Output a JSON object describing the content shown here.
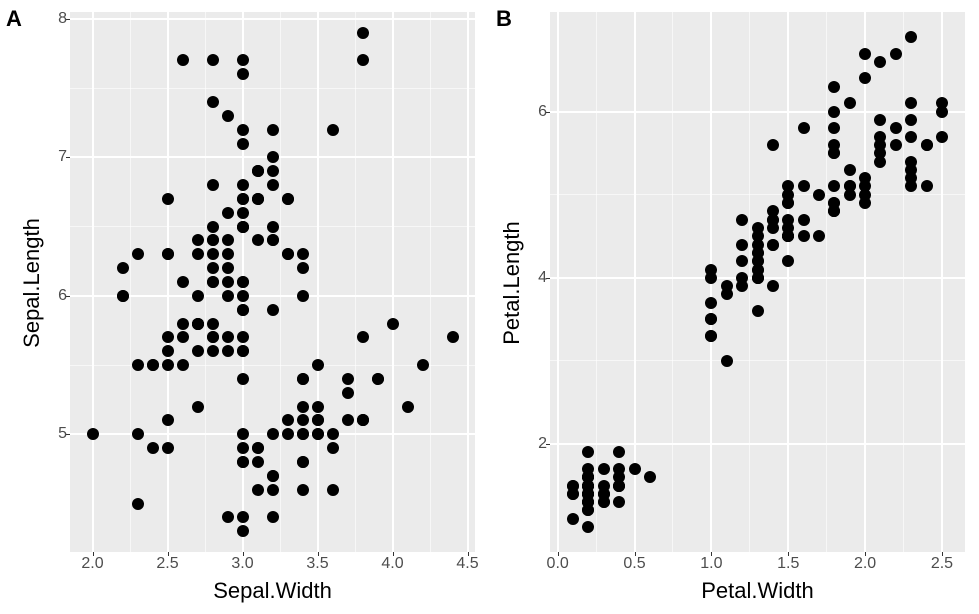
{
  "chart_data": [
    {
      "tag": "A",
      "type": "scatter",
      "xlabel": "Sepal.Width",
      "ylabel": "Sepal.Length",
      "xlim": [
        1.85,
        4.55
      ],
      "ylim": [
        4.15,
        8.05
      ],
      "xTicks": [
        2.0,
        2.5,
        3.0,
        3.5,
        4.0,
        4.5
      ],
      "yTicks": [
        5,
        6,
        7,
        8
      ],
      "xTickLabels": [
        "2.0",
        "2.5",
        "3.0",
        "3.5",
        "4.0",
        "4.5"
      ],
      "yTickLabels": [
        "5",
        "6",
        "7",
        "8"
      ],
      "points": [
        [
          3.5,
          5.1
        ],
        [
          3.0,
          4.9
        ],
        [
          3.2,
          4.7
        ],
        [
          3.1,
          4.6
        ],
        [
          3.6,
          5.0
        ],
        [
          3.9,
          5.4
        ],
        [
          3.4,
          4.6
        ],
        [
          3.4,
          5.0
        ],
        [
          2.9,
          4.4
        ],
        [
          3.1,
          4.9
        ],
        [
          3.7,
          5.4
        ],
        [
          3.4,
          4.8
        ],
        [
          3.0,
          4.8
        ],
        [
          3.0,
          4.3
        ],
        [
          4.0,
          5.8
        ],
        [
          4.4,
          5.7
        ],
        [
          3.9,
          5.4
        ],
        [
          3.5,
          5.1
        ],
        [
          3.8,
          5.7
        ],
        [
          3.8,
          5.1
        ],
        [
          3.4,
          5.4
        ],
        [
          3.7,
          5.1
        ],
        [
          3.6,
          4.6
        ],
        [
          3.3,
          5.1
        ],
        [
          3.4,
          4.8
        ],
        [
          3.0,
          5.0
        ],
        [
          3.4,
          5.0
        ],
        [
          3.5,
          5.2
        ],
        [
          3.4,
          5.2
        ],
        [
          3.2,
          4.7
        ],
        [
          3.1,
          4.8
        ],
        [
          3.4,
          5.4
        ],
        [
          4.1,
          5.2
        ],
        [
          4.2,
          5.5
        ],
        [
          3.1,
          4.9
        ],
        [
          3.2,
          5.0
        ],
        [
          3.5,
          5.5
        ],
        [
          3.6,
          4.9
        ],
        [
          3.0,
          4.4
        ],
        [
          3.4,
          5.1
        ],
        [
          3.5,
          5.0
        ],
        [
          2.3,
          4.5
        ],
        [
          3.2,
          4.4
        ],
        [
          3.5,
          5.0
        ],
        [
          3.8,
          5.1
        ],
        [
          3.0,
          4.8
        ],
        [
          3.8,
          5.1
        ],
        [
          3.2,
          4.6
        ],
        [
          3.7,
          5.3
        ],
        [
          3.3,
          5.0
        ],
        [
          3.2,
          7.0
        ],
        [
          3.2,
          6.4
        ],
        [
          3.1,
          6.9
        ],
        [
          2.3,
          5.5
        ],
        [
          2.8,
          6.5
        ],
        [
          2.8,
          5.7
        ],
        [
          3.3,
          6.3
        ],
        [
          2.4,
          4.9
        ],
        [
          2.9,
          6.6
        ],
        [
          2.7,
          5.2
        ],
        [
          2.0,
          5.0
        ],
        [
          3.0,
          5.9
        ],
        [
          2.2,
          6.0
        ],
        [
          2.9,
          6.1
        ],
        [
          2.9,
          5.6
        ],
        [
          3.1,
          6.7
        ],
        [
          3.0,
          5.6
        ],
        [
          2.7,
          5.8
        ],
        [
          2.2,
          6.2
        ],
        [
          2.5,
          5.6
        ],
        [
          3.2,
          5.9
        ],
        [
          2.8,
          6.1
        ],
        [
          2.5,
          6.3
        ],
        [
          2.8,
          6.1
        ],
        [
          2.9,
          6.4
        ],
        [
          3.0,
          6.6
        ],
        [
          2.8,
          6.8
        ],
        [
          3.0,
          6.7
        ],
        [
          2.9,
          6.0
        ],
        [
          2.6,
          5.7
        ],
        [
          2.4,
          5.5
        ],
        [
          2.4,
          5.5
        ],
        [
          2.7,
          5.8
        ],
        [
          2.7,
          6.0
        ],
        [
          3.0,
          5.4
        ],
        [
          3.4,
          6.0
        ],
        [
          3.1,
          6.7
        ],
        [
          2.3,
          6.3
        ],
        [
          3.0,
          5.6
        ],
        [
          2.5,
          5.5
        ],
        [
          2.6,
          5.5
        ],
        [
          3.0,
          6.1
        ],
        [
          2.6,
          5.8
        ],
        [
          2.3,
          5.0
        ],
        [
          2.7,
          5.6
        ],
        [
          3.0,
          5.7
        ],
        [
          2.9,
          5.7
        ],
        [
          2.9,
          6.2
        ],
        [
          2.5,
          5.1
        ],
        [
          2.8,
          5.7
        ],
        [
          3.3,
          6.3
        ],
        [
          2.7,
          5.8
        ],
        [
          3.0,
          7.1
        ],
        [
          2.9,
          6.3
        ],
        [
          3.0,
          6.5
        ],
        [
          3.0,
          7.6
        ],
        [
          2.5,
          4.9
        ],
        [
          2.9,
          7.3
        ],
        [
          2.5,
          6.7
        ],
        [
          3.6,
          7.2
        ],
        [
          3.2,
          6.5
        ],
        [
          2.7,
          6.4
        ],
        [
          3.0,
          6.8
        ],
        [
          2.5,
          5.7
        ],
        [
          2.8,
          5.8
        ],
        [
          3.2,
          6.4
        ],
        [
          3.0,
          6.5
        ],
        [
          3.8,
          7.7
        ],
        [
          2.6,
          7.7
        ],
        [
          2.2,
          6.0
        ],
        [
          3.2,
          6.9
        ],
        [
          2.8,
          5.6
        ],
        [
          2.8,
          7.7
        ],
        [
          2.7,
          6.3
        ],
        [
          3.3,
          6.7
        ],
        [
          3.2,
          7.2
        ],
        [
          2.8,
          6.2
        ],
        [
          3.0,
          6.1
        ],
        [
          2.8,
          6.4
        ],
        [
          3.0,
          7.2
        ],
        [
          2.8,
          7.4
        ],
        [
          3.8,
          7.9
        ],
        [
          2.8,
          6.4
        ],
        [
          2.8,
          6.3
        ],
        [
          2.6,
          6.1
        ],
        [
          3.0,
          7.7
        ],
        [
          3.4,
          6.3
        ],
        [
          3.1,
          6.4
        ],
        [
          3.0,
          6.0
        ],
        [
          3.1,
          6.9
        ],
        [
          3.1,
          6.7
        ],
        [
          3.1,
          6.9
        ],
        [
          2.7,
          5.8
        ],
        [
          3.2,
          6.8
        ],
        [
          3.3,
          6.7
        ],
        [
          3.0,
          6.7
        ],
        [
          2.5,
          6.3
        ],
        [
          3.0,
          6.5
        ],
        [
          3.4,
          6.2
        ],
        [
          3.0,
          5.9
        ]
      ]
    },
    {
      "tag": "B",
      "type": "scatter",
      "xlabel": "Petal.Width",
      "ylabel": "Petal.Length",
      "xlim": [
        -0.05,
        2.65
      ],
      "ylim": [
        0.7,
        7.2
      ],
      "xTicks": [
        0.0,
        0.5,
        1.0,
        1.5,
        2.0,
        2.5
      ],
      "yTicks": [
        2,
        4,
        6
      ],
      "xTickLabels": [
        "0.0",
        "0.5",
        "1.0",
        "1.5",
        "2.0",
        "2.5"
      ],
      "yTickLabels": [
        "2",
        "4",
        "6"
      ],
      "points": [
        [
          0.2,
          1.4
        ],
        [
          0.2,
          1.4
        ],
        [
          0.2,
          1.3
        ],
        [
          0.2,
          1.5
        ],
        [
          0.2,
          1.4
        ],
        [
          0.4,
          1.7
        ],
        [
          0.3,
          1.4
        ],
        [
          0.2,
          1.5
        ],
        [
          0.2,
          1.4
        ],
        [
          0.1,
          1.5
        ],
        [
          0.2,
          1.5
        ],
        [
          0.2,
          1.6
        ],
        [
          0.1,
          1.4
        ],
        [
          0.1,
          1.1
        ],
        [
          0.2,
          1.2
        ],
        [
          0.4,
          1.5
        ],
        [
          0.4,
          1.3
        ],
        [
          0.3,
          1.4
        ],
        [
          0.3,
          1.7
        ],
        [
          0.3,
          1.5
        ],
        [
          0.2,
          1.7
        ],
        [
          0.4,
          1.5
        ],
        [
          0.2,
          1.0
        ],
        [
          0.5,
          1.7
        ],
        [
          0.2,
          1.9
        ],
        [
          0.2,
          1.6
        ],
        [
          0.4,
          1.6
        ],
        [
          0.2,
          1.5
        ],
        [
          0.2,
          1.4
        ],
        [
          0.2,
          1.6
        ],
        [
          0.2,
          1.6
        ],
        [
          0.4,
          1.5
        ],
        [
          0.1,
          1.5
        ],
        [
          0.2,
          1.4
        ],
        [
          0.2,
          1.5
        ],
        [
          0.2,
          1.2
        ],
        [
          0.2,
          1.3
        ],
        [
          0.1,
          1.4
        ],
        [
          0.2,
          1.3
        ],
        [
          0.2,
          1.5
        ],
        [
          0.3,
          1.3
        ],
        [
          0.3,
          1.3
        ],
        [
          0.2,
          1.3
        ],
        [
          0.6,
          1.6
        ],
        [
          0.4,
          1.9
        ],
        [
          0.3,
          1.4
        ],
        [
          0.2,
          1.6
        ],
        [
          0.2,
          1.4
        ],
        [
          0.2,
          1.5
        ],
        [
          0.2,
          1.4
        ],
        [
          1.4,
          4.7
        ],
        [
          1.5,
          4.5
        ],
        [
          1.5,
          4.9
        ],
        [
          1.3,
          4.0
        ],
        [
          1.5,
          4.6
        ],
        [
          1.3,
          4.5
        ],
        [
          1.6,
          4.7
        ],
        [
          1.0,
          3.3
        ],
        [
          1.3,
          4.6
        ],
        [
          1.4,
          3.9
        ],
        [
          1.0,
          3.5
        ],
        [
          1.5,
          4.2
        ],
        [
          1.0,
          4.0
        ],
        [
          1.4,
          4.7
        ],
        [
          1.3,
          3.6
        ],
        [
          1.4,
          4.4
        ],
        [
          1.5,
          4.5
        ],
        [
          1.0,
          4.1
        ],
        [
          1.5,
          4.5
        ],
        [
          1.1,
          3.9
        ],
        [
          1.8,
          4.8
        ],
        [
          1.3,
          4.0
        ],
        [
          1.5,
          4.9
        ],
        [
          1.2,
          4.7
        ],
        [
          1.3,
          4.3
        ],
        [
          1.4,
          4.4
        ],
        [
          1.4,
          4.8
        ],
        [
          1.7,
          5.0
        ],
        [
          1.5,
          4.5
        ],
        [
          1.0,
          3.5
        ],
        [
          1.1,
          3.8
        ],
        [
          1.0,
          3.7
        ],
        [
          1.2,
          3.9
        ],
        [
          1.6,
          5.1
        ],
        [
          1.5,
          4.5
        ],
        [
          1.6,
          4.5
        ],
        [
          1.5,
          4.7
        ],
        [
          1.3,
          4.4
        ],
        [
          1.3,
          4.1
        ],
        [
          1.3,
          4.0
        ],
        [
          1.2,
          4.4
        ],
        [
          1.4,
          4.6
        ],
        [
          1.2,
          4.0
        ],
        [
          1.0,
          3.3
        ],
        [
          1.3,
          4.2
        ],
        [
          1.2,
          4.2
        ],
        [
          1.3,
          4.2
        ],
        [
          1.3,
          4.3
        ],
        [
          1.1,
          3.0
        ],
        [
          1.3,
          4.1
        ],
        [
          2.5,
          6.0
        ],
        [
          1.9,
          5.1
        ],
        [
          2.1,
          5.9
        ],
        [
          1.8,
          5.6
        ],
        [
          2.2,
          5.8
        ],
        [
          2.1,
          6.6
        ],
        [
          1.7,
          4.5
        ],
        [
          1.8,
          6.3
        ],
        [
          1.8,
          5.8
        ],
        [
          2.5,
          6.1
        ],
        [
          2.0,
          5.1
        ],
        [
          1.9,
          5.3
        ],
        [
          2.1,
          5.5
        ],
        [
          2.0,
          5.0
        ],
        [
          2.4,
          5.1
        ],
        [
          2.3,
          5.3
        ],
        [
          1.8,
          5.5
        ],
        [
          2.2,
          6.7
        ],
        [
          2.3,
          6.9
        ],
        [
          1.5,
          5.0
        ],
        [
          2.3,
          5.7
        ],
        [
          2.0,
          4.9
        ],
        [
          2.0,
          6.7
        ],
        [
          1.8,
          4.9
        ],
        [
          2.1,
          5.7
        ],
        [
          1.8,
          6.0
        ],
        [
          1.8,
          4.8
        ],
        [
          1.8,
          4.9
        ],
        [
          2.1,
          5.6
        ],
        [
          1.6,
          5.8
        ],
        [
          1.9,
          6.1
        ],
        [
          2.0,
          6.4
        ],
        [
          2.2,
          5.6
        ],
        [
          1.5,
          5.1
        ],
        [
          1.4,
          5.6
        ],
        [
          2.3,
          6.1
        ],
        [
          2.4,
          5.6
        ],
        [
          1.8,
          5.5
        ],
        [
          1.8,
          4.8
        ],
        [
          2.1,
          5.4
        ],
        [
          2.4,
          5.6
        ],
        [
          2.3,
          5.1
        ],
        [
          1.9,
          5.1
        ],
        [
          2.3,
          5.9
        ],
        [
          2.5,
          5.7
        ],
        [
          2.3,
          5.2
        ],
        [
          1.9,
          5.0
        ],
        [
          2.0,
          5.2
        ],
        [
          2.3,
          5.4
        ],
        [
          1.8,
          5.1
        ]
      ]
    }
  ]
}
